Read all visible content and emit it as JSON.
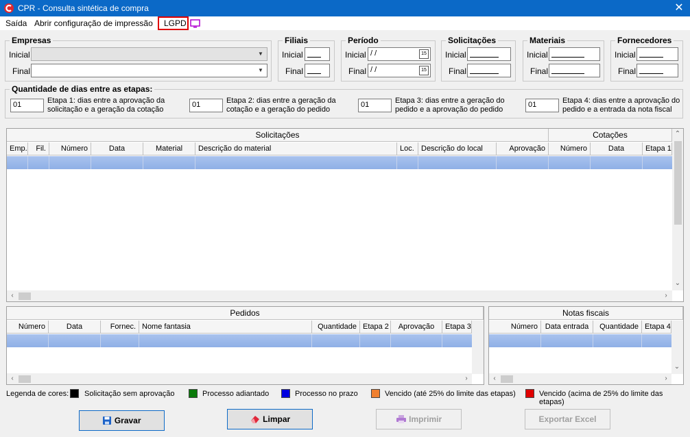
{
  "window": {
    "title": "CPR - Consulta sintética de compra",
    "close": "✕"
  },
  "menu": {
    "saida": "Saída",
    "abrir_config": "Abrir configuração de impressão",
    "lgpd": "LGPD"
  },
  "empresas": {
    "legend": "Empresas",
    "inicial": "Inicial",
    "final": "Final",
    "inicial_value": "",
    "final_value": ""
  },
  "filiais": {
    "legend": "Filiais",
    "inicial": "Inicial",
    "final": "Final"
  },
  "periodo": {
    "legend": "Período",
    "inicial": "Inicial",
    "final": "Final",
    "inicial_value": " /  /",
    "final_value": " /  /",
    "cal_icon": "15"
  },
  "solicitacoes_filter": {
    "legend": "Solicitações",
    "inicial": "Inicial",
    "final": "Final"
  },
  "materiais": {
    "legend": "Materiais",
    "inicial": "Inicial",
    "final": "Final"
  },
  "fornecedores": {
    "legend": "Fornecedores",
    "inicial": "Inicial",
    "final": "Final"
  },
  "etapas": {
    "legend": "Quantidade de dias entre as etapas:",
    "items": [
      {
        "value": "01",
        "line1": "Etapa 1: dias entre a aprovação da",
        "line2": "solicitação e a geração da cotação"
      },
      {
        "value": "01",
        "line1": "Etapa 2: dias entre a geração da",
        "line2": "cotação e a geração do pedido"
      },
      {
        "value": "01",
        "line1": "Etapa 3: dias entre a geração do",
        "line2": "pedido e a aprovação do pedido"
      },
      {
        "value": "01",
        "line1": "Etapa 4: dias entre a aprovação do",
        "line2": "pedido e a entrada da nota fiscal"
      }
    ]
  },
  "grid_solicitacoes": {
    "group1": "Solicitações",
    "group2": "Cotações",
    "cols": [
      "Emp.",
      "Fil.",
      "Número",
      "Data",
      "Material",
      "Descrição do material",
      "Loc.",
      "Descrição do local",
      "Aprovação",
      "Número",
      "Data",
      "Etapa 1"
    ]
  },
  "grid_pedidos": {
    "title": "Pedidos",
    "cols": [
      "Número",
      "Data",
      "Fornec.",
      "Nome fantasia",
      "Quantidade",
      "Etapa 2",
      "Aprovação",
      "Etapa 3"
    ]
  },
  "grid_notas": {
    "title": "Notas fiscais",
    "cols": [
      "Número",
      "Data entrada",
      "Quantidade",
      "Etapa 4"
    ]
  },
  "legend_colors": {
    "label": "Legenda de cores:",
    "items": [
      {
        "text": "Solicitação sem aprovação",
        "color": "#000000"
      },
      {
        "text": "Processo adiantado",
        "color": "#0a7a0a"
      },
      {
        "text": "Processo no prazo",
        "color": "#0000e0"
      },
      {
        "text": "Vencido (até 25% do limite das etapas)",
        "color": "#f08030"
      },
      {
        "text": "Vencido (acima de 25% do limite das etapas)",
        "color": "#e00000"
      }
    ]
  },
  "buttons": {
    "gravar": "Gravar",
    "limpar": "Limpar",
    "imprimir": "Imprimir",
    "exportar": "Exportar Excel"
  }
}
